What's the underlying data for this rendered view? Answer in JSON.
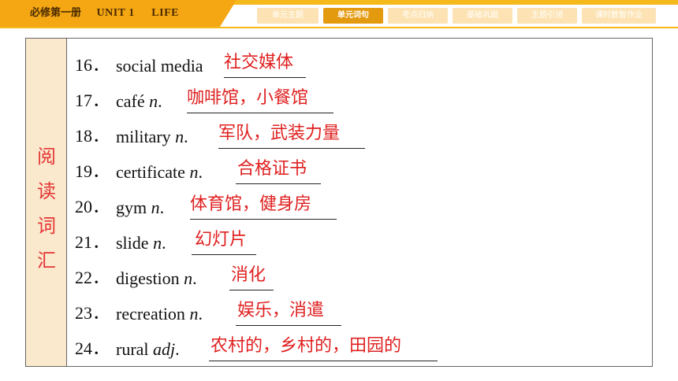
{
  "header": {
    "book_zh": "必修第一册",
    "unit": "UNIT 1",
    "unit_title": "LIFE CHOICES",
    "tabs": [
      "单元主题",
      "单元词句",
      "考点归纳",
      "基础巩固",
      "主题引领",
      "课时数智作业"
    ],
    "active_tab": "单元词句",
    "accent_color": "#f4a713"
  },
  "section": {
    "label_chars": [
      "阅",
      "读",
      "词",
      "汇"
    ],
    "label_color": "#e53535",
    "panel_color": "#fbe9cd"
  },
  "vocab": [
    {
      "num": "16．",
      "word": "social media",
      "pos": "",
      "answer": "社交媒体"
    },
    {
      "num": "17．",
      "word": "café ",
      "pos": "n",
      "answer": "咖啡馆，小餐馆"
    },
    {
      "num": "18．",
      "word": "military ",
      "pos": "n",
      "answer": "军队，武装力量"
    },
    {
      "num": "19．",
      "word": "certificate ",
      "pos": "n",
      "answer": "合格证书"
    },
    {
      "num": "20．",
      "word": "gym ",
      "pos": "n",
      "answer": "体育馆，健身房"
    },
    {
      "num": "21．",
      "word": "slide ",
      "pos": "n",
      "answer": "幻灯片"
    },
    {
      "num": "22．",
      "word": "digestion ",
      "pos": "n",
      "answer": "消化"
    },
    {
      "num": "23．",
      "word": "recreation ",
      "pos": "n",
      "answer": "娱乐，消遣"
    },
    {
      "num": "24．",
      "word": "rural ",
      "pos": "adj",
      "answer": "农村的，乡村的，田园的"
    }
  ]
}
